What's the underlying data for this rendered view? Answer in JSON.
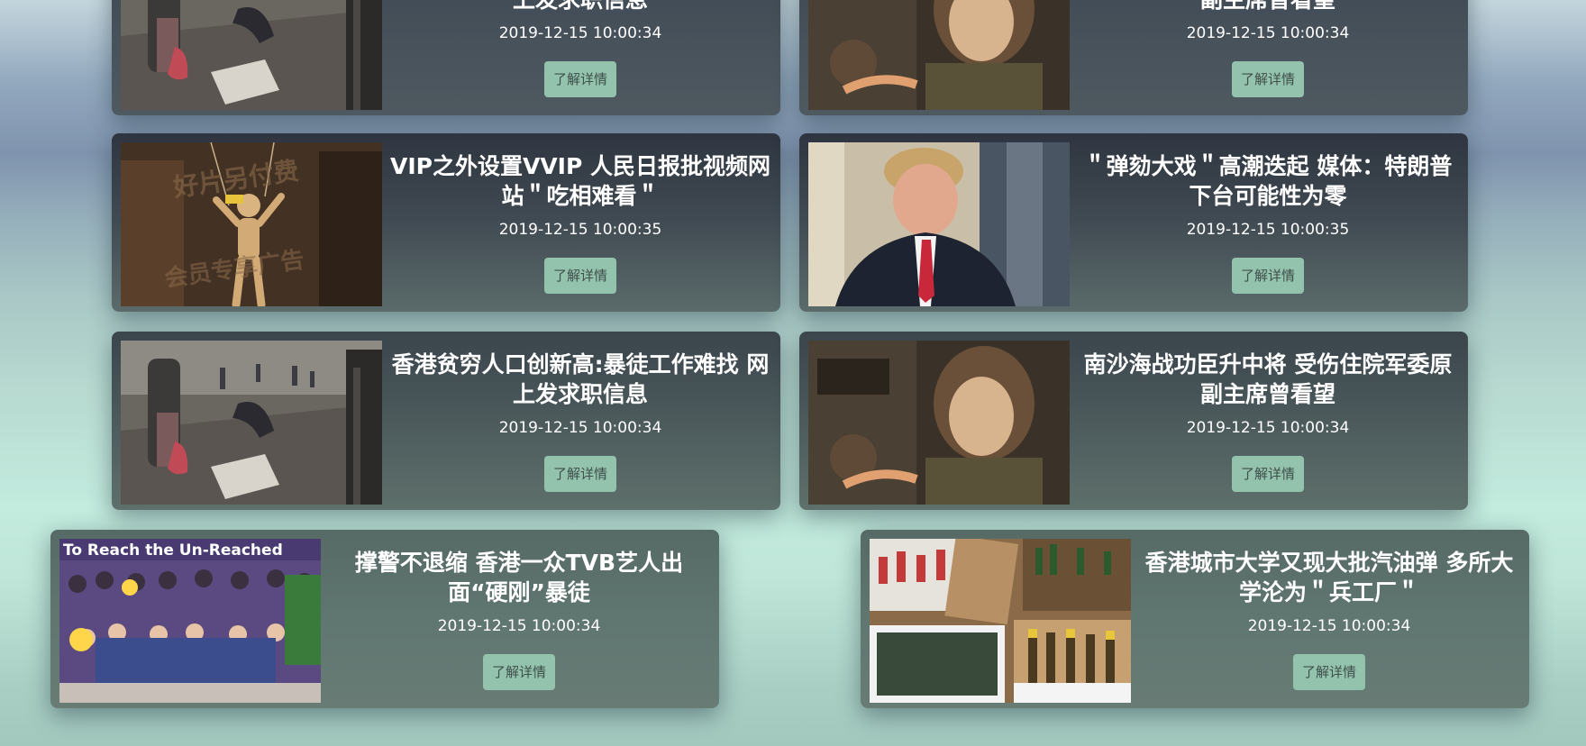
{
  "news": [
    {
      "title": "香港贫穷人口创新高:暴徒工作难找 网上发求职信息",
      "date": "2019-12-15 10:00:34",
      "button": "了解详情",
      "image": "hk-street-photo"
    },
    {
      "title": "南沙海战功臣升中将 受伤住院军委原副主席曾看望",
      "date": "2019-12-15 10:00:34",
      "button": "了解详情",
      "image": "tank-soldier-photo"
    },
    {
      "title": "VIP之外设置VVIP 人民日报批视频网站＂吃相难看＂",
      "date": "2019-12-15 10:00:35",
      "button": "了解详情",
      "image": "vip-puppet-photo"
    },
    {
      "title": "＂弹劾大戏＂高潮迭起 媒体：特朗普下台可能性为零",
      "date": "2019-12-15 10:00:35",
      "button": "了解详情",
      "image": "trump-portrait-photo"
    },
    {
      "title": "香港贫穷人口创新高:暴徒工作难找 网上发求职信息",
      "date": "2019-12-15 10:00:34",
      "button": "了解详情",
      "image": "hk-street-photo"
    },
    {
      "title": "南沙海战功臣升中将 受伤住院军委原副主席曾看望",
      "date": "2019-12-15 10:00:34",
      "button": "了解详情",
      "image": "tank-soldier-photo"
    },
    {
      "title": "撑警不退缩 香港一众TVB艺人出面“硬刚”暴徒",
      "date": "2019-12-15 10:00:34",
      "button": "了解详情",
      "image": "tvb-group-photo",
      "image_caption": "To Reach the Un-Reached"
    },
    {
      "title": "香港城市大学又现大批汽油弹 多所大学沦为＂兵工厂＂",
      "date": "2019-12-15 10:00:34",
      "button": "了解详情",
      "image": "petrol-bombs-photo"
    }
  ]
}
